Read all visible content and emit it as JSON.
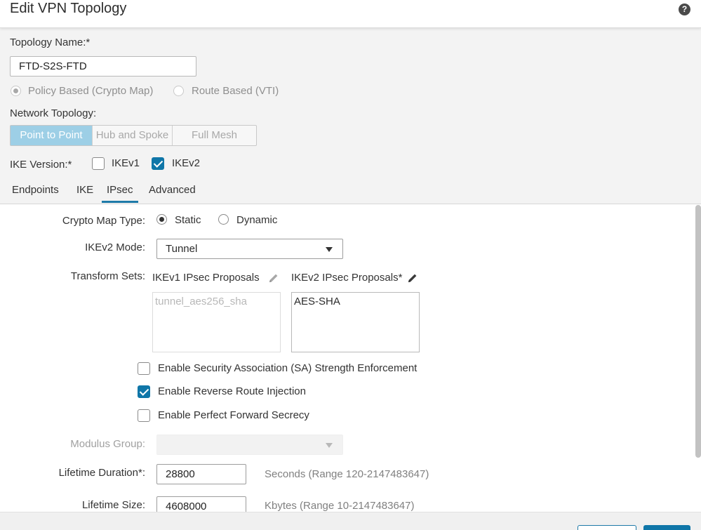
{
  "dialog": {
    "title": "Edit VPN Topology",
    "help_icon": "?"
  },
  "topology_name": {
    "label": "Topology Name:*",
    "value": "FTD-S2S-FTD"
  },
  "vpn_type": {
    "options": [
      {
        "label": "Policy Based (Crypto Map)",
        "selected": true
      },
      {
        "label": "Route Based (VTI)",
        "selected": false
      }
    ]
  },
  "network_topology": {
    "label": "Network Topology:",
    "options": [
      "Point to Point",
      "Hub and Spoke",
      "Full Mesh"
    ],
    "selected": "Point to Point"
  },
  "ike_version": {
    "label": "IKE Version:*",
    "ikev1": {
      "label": "IKEv1",
      "checked": false
    },
    "ikev2": {
      "label": "IKEv2",
      "checked": true
    }
  },
  "tabs": [
    "Endpoints",
    "IKE",
    "IPsec",
    "Advanced"
  ],
  "active_tab": "IPsec",
  "ipsec": {
    "crypto_map_type": {
      "label": "Crypto Map Type:",
      "static": "Static",
      "dynamic": "Dynamic",
      "selected": "Static"
    },
    "ikev2_mode": {
      "label": "IKEv2 Mode:",
      "value": "Tunnel"
    },
    "transform_sets": {
      "label": "Transform Sets:",
      "ikev1_label": "IKEv1 IPsec Proposals",
      "ikev2_label": "IKEv2 IPsec Proposals*",
      "ikev1_items": [
        "tunnel_aes256_sha"
      ],
      "ikev2_items": [
        "AES-SHA"
      ]
    },
    "options": {
      "sa_strength": {
        "label": "Enable Security Association (SA) Strength Enforcement",
        "checked": false
      },
      "rri": {
        "label": "Enable Reverse Route Injection",
        "checked": true
      },
      "pfs": {
        "label": "Enable Perfect Forward Secrecy",
        "checked": false
      }
    },
    "modulus_group": {
      "label": "Modulus Group:",
      "value": ""
    },
    "lifetime_duration": {
      "label": "Lifetime Duration*:",
      "value": "28800",
      "hint": "Seconds (Range 120-2147483647)"
    },
    "lifetime_size": {
      "label": "Lifetime Size:",
      "value": "4608000",
      "hint": "Kbytes (Range 10-2147483647)"
    }
  },
  "colors": {
    "accent": "#0f76a8",
    "segment_active": "#9dcfe6"
  }
}
